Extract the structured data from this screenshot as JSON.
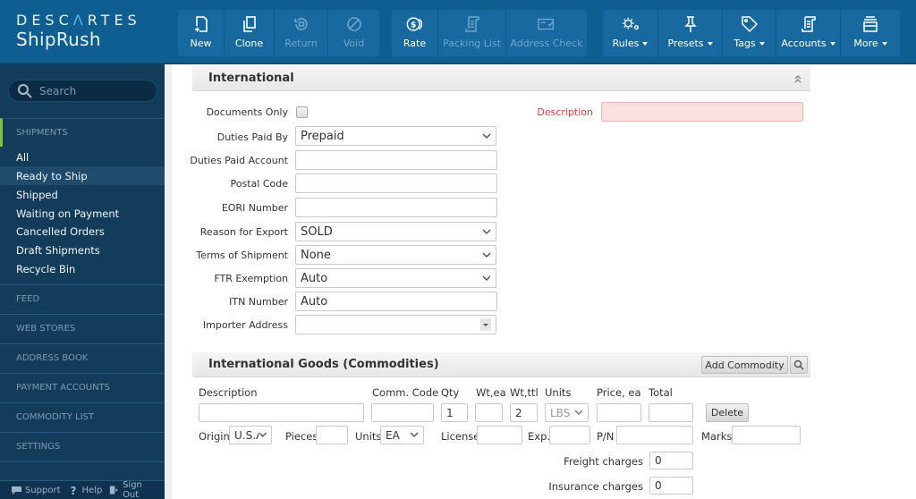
{
  "logo": {
    "brand_left": "DESC",
    "brand_accent": "Λ",
    "brand_right": "RTES",
    "product": "ShipRush"
  },
  "toolbar": {
    "group1": [
      {
        "label": "New",
        "icon": "new-document-icon",
        "enabled": true
      },
      {
        "label": "Clone",
        "icon": "clone-icon",
        "enabled": true
      },
      {
        "label": "Return",
        "icon": "return-icon",
        "enabled": false
      },
      {
        "label": "Void",
        "icon": "void-icon",
        "enabled": false
      }
    ],
    "group2": [
      {
        "label": "Rate",
        "icon": "rate-coins-icon",
        "enabled": true
      },
      {
        "label": "Packing List",
        "icon": "packing-list-icon",
        "enabled": false
      },
      {
        "label": "Address Check",
        "icon": "address-check-icon",
        "enabled": false
      }
    ],
    "group3": [
      {
        "label": "Rules",
        "icon": "gears-icon",
        "dropdown": true
      },
      {
        "label": "Presets",
        "icon": "pin-icon",
        "dropdown": true
      },
      {
        "label": "Tags",
        "icon": "tag-icon",
        "dropdown": true
      },
      {
        "label": "Accounts",
        "icon": "scroll-icon",
        "dropdown": true
      },
      {
        "label": "More",
        "icon": "drawer-icon",
        "dropdown": true
      }
    ]
  },
  "sidebar": {
    "search_placeholder": "Search",
    "shipments_header": "SHIPMENTS",
    "shipments_items": [
      "All",
      "Ready to Ship",
      "Shipped",
      "Waiting on Payment",
      "Cancelled Orders",
      "Draft Shipments",
      "Recycle Bin"
    ],
    "selected_item": "Ready to Ship",
    "sections": [
      "FEED",
      "WEB STORES",
      "ADDRESS BOOK",
      "PAYMENT ACCOUNTS",
      "COMMODITY LIST",
      "SETTINGS"
    ],
    "footer": {
      "support": "Support",
      "help": "Help",
      "sign_out": "Sign Out"
    }
  },
  "international": {
    "title": "International",
    "fields": {
      "documents_only": {
        "label": "Documents Only",
        "checked": false
      },
      "duties_paid_by": {
        "label": "Duties Paid By",
        "value": "Prepaid"
      },
      "duties_paid_account": {
        "label": "Duties Paid Account",
        "value": ""
      },
      "postal_code": {
        "label": "Postal Code",
        "value": ""
      },
      "eori_number": {
        "label": "EORI Number",
        "value": ""
      },
      "reason_for_export": {
        "label": "Reason for Export",
        "value": "SOLD"
      },
      "terms_of_shipment": {
        "label": "Terms of Shipment",
        "value": "None"
      },
      "ftr_exemption": {
        "label": "FTR Exemption",
        "value": "Auto"
      },
      "itn_number": {
        "label": "ITN Number",
        "value": "Auto"
      },
      "importer_address": {
        "label": "Importer Address",
        "value": ""
      },
      "description": {
        "label": "Description",
        "value": "",
        "required": true
      }
    }
  },
  "commodities": {
    "title": "International Goods (Commodities)",
    "add_button": "Add Commodity",
    "columns": [
      "Description",
      "Comm. Code",
      "Qty",
      "Wt,ea",
      "Wt,ttl",
      "Units",
      "Price, ea",
      "Total"
    ],
    "row": {
      "description": "",
      "comm_code": "",
      "qty": "1",
      "wt_ea": "",
      "wt_ttl": "2",
      "units": "LBS",
      "price_ea": "",
      "total": "",
      "delete_label": "Delete",
      "origin_label": "Origin",
      "origin": "U.S.A",
      "pieces_label": "Pieces",
      "pieces": "",
      "units2_label": "Units",
      "units2": "EA",
      "license_label": "License",
      "license": "",
      "exp_label": "Exp.",
      "exp": "",
      "pn_label": "P/N",
      "pn": "",
      "marks_label": "Marks",
      "marks": ""
    },
    "freight": {
      "label": "Freight charges",
      "value": "0"
    },
    "insurance": {
      "label": "Insurance charges",
      "value": "0"
    }
  }
}
